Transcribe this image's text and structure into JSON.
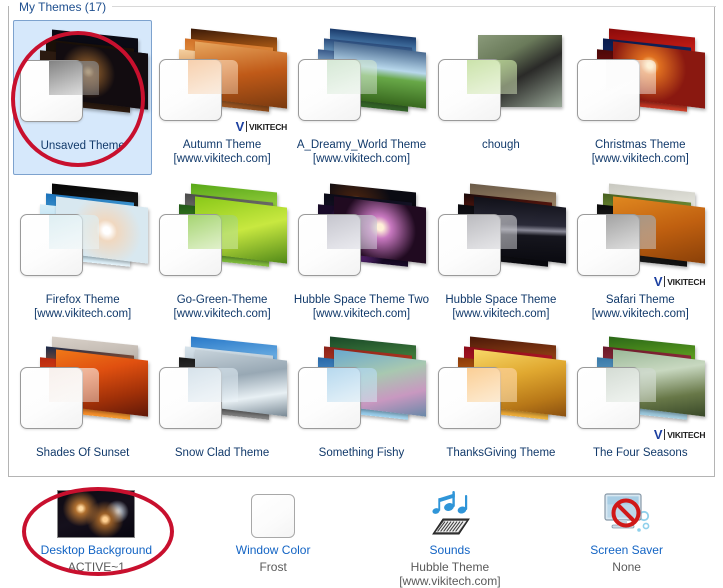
{
  "panel": {
    "header_label": "My Themes (17)"
  },
  "themes": [
    {
      "name": "Unsaved Theme",
      "selected": true,
      "has_logo": false,
      "winprev_glass": "linear-gradient(160deg, rgba(120,120,120,0.92), rgba(200,200,200,0.35))",
      "wallpapers": [
        "#0a0a14",
        "#1a1008",
        "#2b1a10",
        "radial-gradient(circle at 35% 45%, #f0c078 2%, #8a5a2a 9%, #120c10 40%), radial-gradient(circle at 70% 70%, #e8b070 3%, #6a4020 11%, #0a0810 45%)"
      ]
    },
    {
      "name": "Autumn Theme\n[www.vikitech.com]",
      "selected": false,
      "has_logo": true,
      "winprev_glass": "linear-gradient(160deg, rgba(245,200,160,0.85), rgba(250,225,200,0.40))",
      "wallpapers": [
        "linear-gradient(170deg,#3a1a08,#c86a18,#f0b040)",
        "linear-gradient(175deg,#d07028,#f0a850,#8a4a18)",
        "linear-gradient(170deg,#f5d0a0,#c87838,#8a4818)",
        "linear-gradient(165deg,#e8a860,#c05a18,#7a3a10)"
      ]
    },
    {
      "name": "A_Dreamy_World Theme\n[www.vikitech.com]",
      "selected": false,
      "has_logo": false,
      "winprev_glass": "linear-gradient(160deg, rgba(200,225,200,0.75), rgba(235,245,235,0.40))",
      "wallpapers": [
        "linear-gradient(180deg,#1a3a6a 0%,#6aa8d8 45%,#3a7a30 60%,#2a5a20 100%)",
        "linear-gradient(180deg,#2a4a7a 0%,#88c0e0 40%,#4a8a38 58%,#2a5a22 100%)",
        "linear-gradient(180deg,#3a5a8a 0%,#a8d0e8 40%,#5a9a40 56%,#306026 100%)",
        "linear-gradient(180deg,#4a6a90 0%,#b8d8ec 38%,#68a848 54%,#38681e 100%)"
      ]
    },
    {
      "name": "chough",
      "selected": false,
      "has_logo": false,
      "single": true,
      "winprev_glass": "linear-gradient(160deg, rgba(190,220,150,0.80), rgba(225,240,200,0.45))",
      "wallpapers": [
        "linear-gradient(150deg,#8a9a7a 0%,#6a7a5a 30%,#2a2a28 55%,#9aa898 100%)"
      ]
    },
    {
      "name": "Christmas Theme\n[www.vikitech.com]",
      "selected": false,
      "has_logo": false,
      "winprev_glass": "linear-gradient(160deg, rgba(250,250,250,0.70), rgba(255,255,255,0.40))",
      "wallpapers": [
        "linear-gradient(170deg,#8a0a0a,#d02018,#f06030)",
        "linear-gradient(170deg,#0a1a4a,#183070,#0a1230)",
        "linear-gradient(170deg,#4a0808,#8a1010,#d04028)",
        "radial-gradient(circle at 40% 35%, #ffe0a0 4%, #e07020 14%, #8a1810 55%)"
      ]
    },
    {
      "name": "Firefox Theme\n[www.vikitech.com]",
      "selected": false,
      "has_logo": false,
      "winprev_glass": "linear-gradient(160deg, rgba(215,235,240,0.80), rgba(240,248,250,0.45))",
      "wallpapers": [
        "linear-gradient(170deg,#050505,#1a1a1a,#3a2a10)",
        "linear-gradient(170deg,#1a70b8,#58b0e0,#0a4878)",
        "linear-gradient(170deg,#d8eef8,#a8d8ee,#e8f4fa)",
        "radial-gradient(circle at 55% 50%, #ffffff 6%, #f0d8c0 18%, #d8e8f0 60%)"
      ]
    },
    {
      "name": "Go-Green-Theme\n[www.vikitech.com]",
      "selected": false,
      "has_logo": false,
      "winprev_glass": "linear-gradient(160deg, rgba(150,205,90,0.85), rgba(215,238,180,0.50))",
      "wallpapers": [
        "linear-gradient(170deg,#58a818,#9ad040,#d8ee90)",
        "linear-gradient(170deg,#4a4a4a,#8a8a80,#2a2a28)",
        "linear-gradient(170deg,#205818,#4a9820,#88c040)",
        "linear-gradient(160deg,#88c818,#c8e840,#508818)"
      ]
    },
    {
      "name": "Hubble Space Theme Two\n[www.vikitech.com]",
      "selected": false,
      "has_logo": false,
      "winprev_glass": "linear-gradient(160deg, rgba(185,185,195,0.82), rgba(225,225,235,0.45))",
      "wallpapers": [
        "radial-gradient(circle at 30% 40%, #f0c070 4%, #402010 16%, #0a0a12 55%)",
        "linear-gradient(170deg,#0a0a16,#1a1830,#08080e)",
        "radial-gradient(circle at 45% 50%, #f8e0ff 5%, #a040c8 18%, #180a28 60%)",
        "radial-gradient(circle at 50% 45%, #fff0d8 6%, #c878c0 20%, #200a20 65%)"
      ]
    },
    {
      "name": "Hubble Space Theme\n[www.vikitech.com]",
      "selected": false,
      "has_logo": false,
      "winprev_glass": "linear-gradient(160deg, rgba(175,175,180,0.85), rgba(220,220,225,0.48))",
      "wallpapers": [
        "linear-gradient(170deg,#6a5a48,#a08868,#3a2a1a)",
        "linear-gradient(170deg,#1a0a0a,#8a2010,#d04828)",
        "linear-gradient(170deg,#0a0a0e,#1a1a22,#08080c)",
        "linear-gradient(175deg,#101018 0%,#2a2a38 42%,#8a8a98 50%,#16161e 58%,#0a0a10 100%)"
      ]
    },
    {
      "name": "Safari Theme\n[www.vikitech.com]",
      "selected": false,
      "has_logo": true,
      "winprev_glass": "linear-gradient(160deg, rgba(150,150,150,0.88), rgba(210,210,210,0.50))",
      "wallpapers": [
        "linear-gradient(170deg,#c8c8c0,#e8e8e0,#a8a8a0)",
        "linear-gradient(170deg,#486020,#88a840,#d8c060)",
        "linear-gradient(170deg,#0a0a0a,#2a2a2a,#101010)",
        "linear-gradient(160deg,#e08820,#c06010,#8a4008)"
      ]
    },
    {
      "name": "Shades Of Sunset",
      "selected": false,
      "has_logo": false,
      "winprev_glass": "linear-gradient(160deg, rgba(245,235,230,0.72), rgba(252,248,245,0.42))",
      "wallpapers": [
        "linear-gradient(170deg,#d8d0c8,#b8b0a8,#88807a)",
        "linear-gradient(170deg,#1a2a4a,#d86820,#f8c040)",
        "linear-gradient(170deg,#b82810,#e85818,#f8a030)",
        "linear-gradient(160deg,#f07818 0%,#e05010 35%,#a03008 70%,#601808 100%)"
      ]
    },
    {
      "name": "Snow Clad Theme",
      "selected": false,
      "has_logo": false,
      "winprev_glass": "linear-gradient(160deg, rgba(205,220,230,0.80), rgba(238,245,250,0.45))",
      "wallpapers": [
        "linear-gradient(170deg,#2878c8,#78b8e8,#c8e4f4)",
        "linear-gradient(170deg,#d8e4ec,#a8b8c4,#687888)",
        "linear-gradient(170deg,#181818,#484848,#888888)",
        "linear-gradient(165deg,#c8d4dc 0%,#98a8b4 40%,#e8f0f4 70%,#788894 100%)"
      ]
    },
    {
      "name": "Something Fishy",
      "selected": false,
      "has_logo": false,
      "winprev_glass": "linear-gradient(160deg, rgba(170,210,235,0.85), rgba(220,238,248,0.48))",
      "wallpapers": [
        "linear-gradient(170deg,#184828,#4a8840,#88b860)",
        "linear-gradient(170deg,#8a2018,#c84828,#a83820)",
        "linear-gradient(170deg,#2868a8,#68a8d8,#a8d8f0)",
        "linear-gradient(160deg,#68a8d0 0%,#a8c8b0 40%,#c898c0 70%,#6888a8 100%)"
      ]
    },
    {
      "name": "ThanksGiving Theme",
      "selected": false,
      "has_logo": false,
      "winprev_glass": "linear-gradient(160deg, rgba(250,200,135,0.88), rgba(253,228,190,0.52))",
      "wallpapers": [
        "linear-gradient(170deg,#4a1808,#a04818,#d88830)",
        "linear-gradient(170deg,#8a0a18,#c82030,#f06040)",
        "linear-gradient(170deg,#8a3808,#d87818,#f0b840)",
        "linear-gradient(160deg,#f8d868 0%,#e0a830 40%,#b87818 75%,#8a5010 100%)"
      ]
    },
    {
      "name": "The Four Seasons",
      "selected": false,
      "has_logo": true,
      "winprev_glass": "linear-gradient(160deg, rgba(200,210,200,0.78), rgba(235,242,235,0.45))",
      "wallpapers": [
        "linear-gradient(170deg,#2a6818,#68a820,#a8d040)",
        "linear-gradient(170deg,#681828,#a83848,#c86858)",
        "linear-gradient(170deg,#3878a8,#78b0d0,#a8d0e0)",
        "linear-gradient(165deg,#9ab898 0%,#c8d8c0 35%,#687848 70%,#384828 100%)"
      ]
    }
  ],
  "settings": [
    {
      "icon": "desktop-background-thumbnail",
      "label": "Desktop Background",
      "value": "ACTIVE~1"
    },
    {
      "icon": "window-color-swatch",
      "label": "Window Color",
      "value": "Frost"
    },
    {
      "icon": "sounds-icon",
      "label": "Sounds",
      "value": "Hubble Theme [www.vikitech.com]"
    },
    {
      "icon": "screen-saver-icon",
      "label": "Screen Saver",
      "value": "None"
    }
  ],
  "colors": {
    "header_text": "#1e4f8f",
    "theme_label": "#123a6b",
    "link": "#1364c4",
    "value_text": "#5a5a5a",
    "selection_bg": "#d6e8fb",
    "selection_border": "#7da2ce",
    "annotation": "#c8102e"
  }
}
